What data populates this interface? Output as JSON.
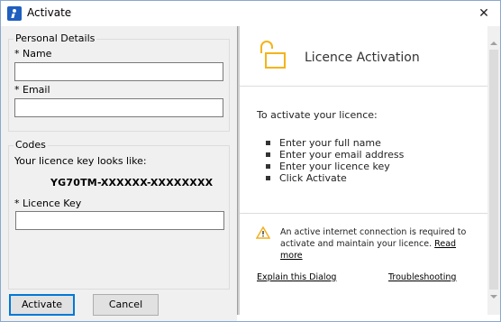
{
  "window": {
    "title": "Activate",
    "close_glyph": "✕"
  },
  "personal_details": {
    "group_title": "Personal Details",
    "name_label": "* Name",
    "name_value": "",
    "email_label": "* Email",
    "email_value": ""
  },
  "codes": {
    "group_title": "Codes",
    "hint": "Your licence key looks like:",
    "sample_key": "YG70TM-XXXXXX-XXXXXXXX",
    "key_label": "* Licence Key",
    "key_value": ""
  },
  "buttons": {
    "activate": "Activate",
    "cancel": "Cancel"
  },
  "info_panel": {
    "heading": "Licence Activation",
    "intro": "To activate your licence:",
    "steps": [
      "Enter your full name",
      "Enter your email address",
      "Enter your licence key",
      "Click Activate"
    ],
    "warning_text": "An active internet connection is required to activate and maintain your licence.",
    "read_more": "Read more",
    "link_explain": "Explain this Dialog",
    "link_troubleshooting": "Troubleshooting"
  },
  "colors": {
    "accent": "#0078d7",
    "warning": "#f2b01e",
    "lock": "#f5b31a"
  }
}
